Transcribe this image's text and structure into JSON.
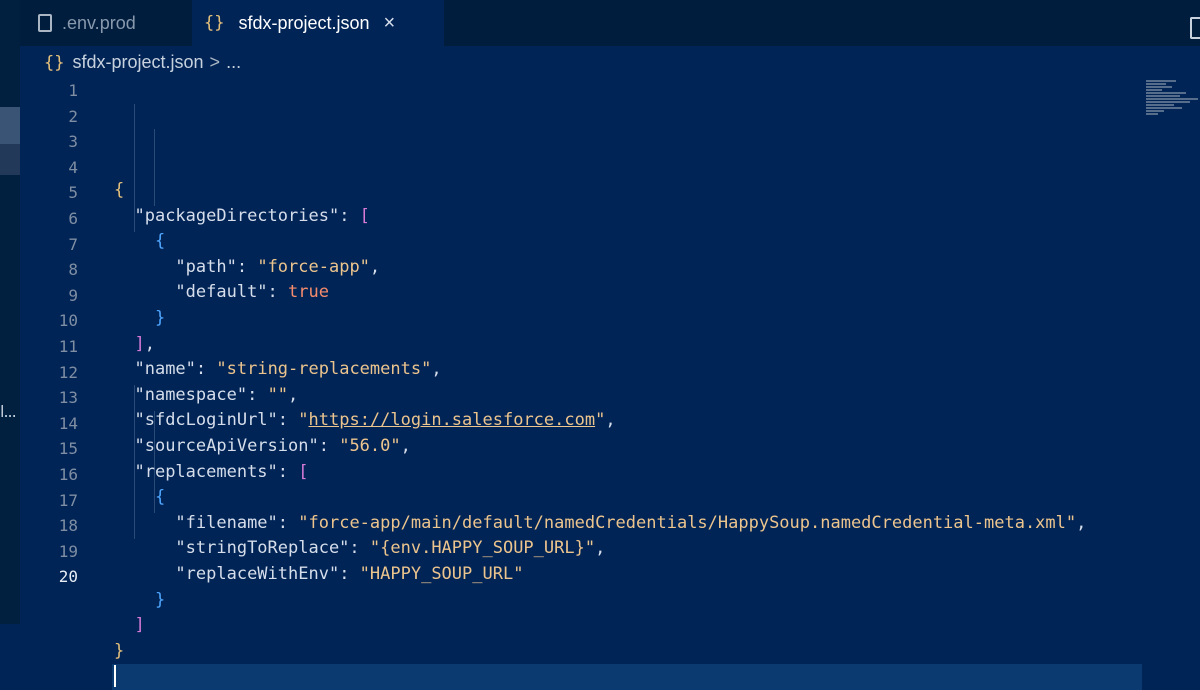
{
  "tabs": [
    {
      "label": ".env.prod",
      "icon": "file-icon",
      "active": false
    },
    {
      "label": "sfdx-project.json",
      "icon": "json-braces-icon",
      "active": true,
      "close": "×"
    }
  ],
  "breadcrumb": {
    "icon": "{}",
    "file": "sfdx-project.json",
    "separator": ">",
    "more": "..."
  },
  "sidebar_label": "l...",
  "editor": {
    "line_numbers": [
      "1",
      "2",
      "3",
      "4",
      "5",
      "6",
      "7",
      "8",
      "9",
      "10",
      "11",
      "12",
      "13",
      "14",
      "15",
      "16",
      "17",
      "18",
      "19",
      "20"
    ],
    "active_line": "20",
    "lines": [
      "{",
      "  \"packageDirectories\": [",
      "    {",
      "      \"path\": \"force-app\",",
      "      \"default\": true",
      "    }",
      "  ],",
      "  \"name\": \"string-replacements\",",
      "  \"namespace\": \"\",",
      "  \"sfdcLoginUrl\": \"https://login.salesforce.com\",",
      "  \"sourceApiVersion\": \"56.0\",",
      "  \"replacements\": [",
      "    {",
      "      \"filename\": \"force-app/main/default/namedCredentials/HappySoup.namedCredential-meta.xml\",",
      "      \"stringToReplace\": \"{env.HAPPY_SOUP_URL}\",",
      "      \"replaceWithEnv\": \"HAPPY_SOUP_URL\"",
      "    }",
      "  ]",
      "}",
      ""
    ]
  },
  "colors": {
    "background": "#012456",
    "string": "#ecc48d",
    "brace_level1": "#e5c07b",
    "bracket_level2": "#d77bd7",
    "brace_level3": "#4fa7ff"
  }
}
